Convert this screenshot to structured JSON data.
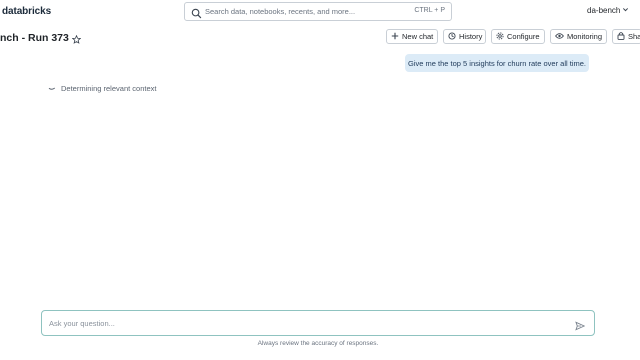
{
  "app": {
    "logo_text": "databricks"
  },
  "search": {
    "placeholder": "Search data, notebooks, recents, and more...",
    "shortcut": "CTRL + P"
  },
  "workspace": {
    "name": "da-bench"
  },
  "page": {
    "title": "nch - Run 373"
  },
  "toolbar": {
    "new_chat": "New chat",
    "history": "History",
    "configure": "Configure",
    "monitoring": "Monitoring",
    "share": "Sha"
  },
  "conversation": {
    "user_message": "Give me the top 5 insights for churn rate over all time.",
    "status_text": "Determining relevant context"
  },
  "composer": {
    "placeholder": "Ask your question...",
    "disclaimer": "Always review the accuracy of responses."
  }
}
